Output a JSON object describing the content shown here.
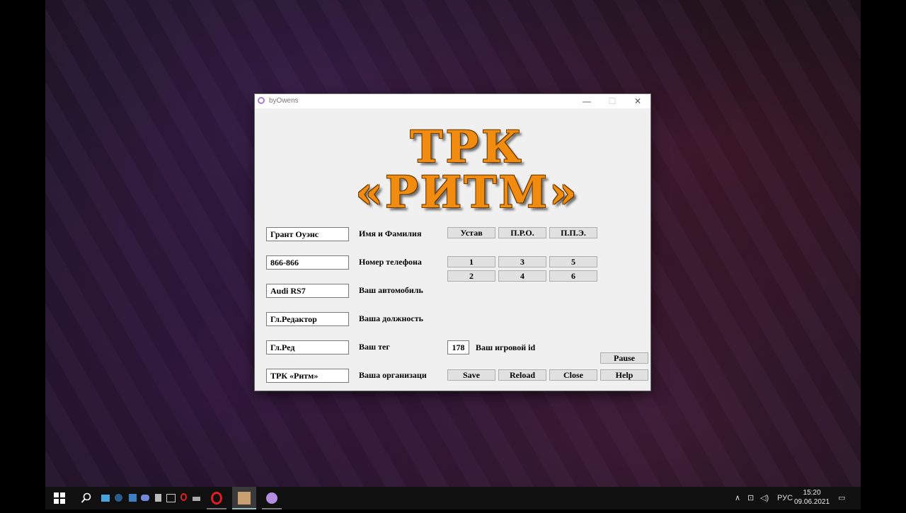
{
  "window": {
    "title": "byOwens",
    "controls": {
      "minimize": "—",
      "maximize": "☐",
      "close": "✕"
    }
  },
  "logo": {
    "line1": "ТРК",
    "line2": "«РИТМ»"
  },
  "fields": [
    {
      "value": "Грант Оуэнс",
      "label": "Имя и Фамилия"
    },
    {
      "value": "866-866",
      "label": "Номер телефона"
    },
    {
      "value": "Audi RS7",
      "label": "Ваш автомобиль"
    },
    {
      "value": "Гл.Редактор",
      "label": "Ваша должность"
    },
    {
      "value": "Гл.Ред",
      "label": "Ваш тег"
    },
    {
      "value": "ТРК «Ритм»",
      "label": "Ваша организаци"
    }
  ],
  "game_id": {
    "value": "178",
    "label": "Ваш игровой id"
  },
  "top_buttons": [
    "Устав",
    "П.Р.О.",
    "П.П.Э."
  ],
  "number_buttons": [
    "1",
    "3",
    "5",
    "2",
    "4",
    "6"
  ],
  "bottom_buttons": {
    "pause": "Pause",
    "save": "Save",
    "reload": "Reload",
    "close": "Close",
    "help": "Help"
  },
  "taskbar": {
    "tray": {
      "lang": "РУС",
      "time": "15:20",
      "date": "09.06.2021"
    }
  },
  "colors": {
    "logo": "#f28c10",
    "window_bg": "#f0f0f0",
    "taskbar": "#101010"
  }
}
